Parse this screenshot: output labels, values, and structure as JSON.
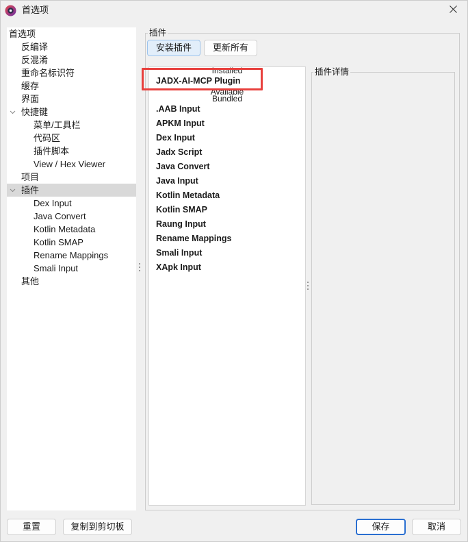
{
  "window": {
    "title": "首选项"
  },
  "icons": {
    "app": "jadx-logo-icon",
    "close": "close-icon",
    "expand": "chevron-down-icon",
    "splitter": "splitter-grip-icon"
  },
  "colors": {
    "highlight_annotation": "#e8403d",
    "selection": "#d9d9d9",
    "accent": "#2a6fd1"
  },
  "tree": [
    {
      "label": "首选项",
      "expanded": true,
      "children": [
        {
          "label": "反编译"
        },
        {
          "label": "反混淆"
        },
        {
          "label": "重命名标识符"
        },
        {
          "label": "缓存"
        },
        {
          "label": "界面"
        },
        {
          "label": "快捷键",
          "expanded": true,
          "children": [
            {
              "label": "菜单/工具栏"
            },
            {
              "label": "代码区"
            },
            {
              "label": "插件脚本"
            },
            {
              "label": "View / Hex Viewer"
            }
          ]
        },
        {
          "label": "项目"
        },
        {
          "label": "插件",
          "expanded": true,
          "selected": true,
          "children": [
            {
              "label": "Dex Input"
            },
            {
              "label": "Java Convert"
            },
            {
              "label": "Kotlin Metadata"
            },
            {
              "label": "Kotlin SMAP"
            },
            {
              "label": "Rename Mappings"
            },
            {
              "label": "Smali Input"
            }
          ]
        },
        {
          "label": "其他"
        }
      ]
    }
  ],
  "plugins": {
    "group_label": "插件",
    "install_button": "安装插件",
    "update_all_button": "更新所有",
    "details_label": "插件详情",
    "sections": [
      {
        "header": "Installed",
        "items": [
          {
            "name": "JADX-AI-MCP Plugin",
            "highlighted": true
          }
        ]
      },
      {
        "header": "Available",
        "items": []
      },
      {
        "header": "Bundled",
        "items": [
          {
            "name": ".AAB Input"
          },
          {
            "name": "APKM Input"
          },
          {
            "name": "Dex Input"
          },
          {
            "name": "Jadx Script"
          },
          {
            "name": "Java Convert"
          },
          {
            "name": "Java Input"
          },
          {
            "name": "Kotlin Metadata"
          },
          {
            "name": "Kotlin SMAP"
          },
          {
            "name": "Raung Input"
          },
          {
            "name": "Rename Mappings"
          },
          {
            "name": "Smali Input"
          },
          {
            "name": "XApk Input"
          }
        ]
      }
    ]
  },
  "footer": {
    "reset": "重置",
    "copy": "复制到剪切板",
    "save": "保存",
    "cancel": "取消"
  }
}
